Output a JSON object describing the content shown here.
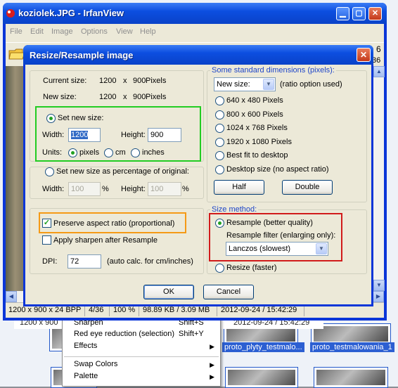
{
  "main_window": {
    "title": "koziolek.JPG - IrfanView",
    "menu": [
      "File",
      "Edit",
      "Image",
      "Options",
      "View",
      "Help"
    ],
    "toolbar_fragments": [
      "6",
      "36"
    ],
    "statusbar": {
      "dimensions": "1200 x 900 x 24 BPP",
      "index": "4/36",
      "zoom": "100 %",
      "size": "98.89 KB / 3.09 MB",
      "date": "2012-09-24 / 15:42:29"
    }
  },
  "background": {
    "status_dims": "1200 x 900",
    "status_date": "2012-09-24 / 15:42:29",
    "thumb_label_1": "proto_plyty_testmalo...",
    "thumb_label_2": "proto_testmalowania_1"
  },
  "context_menu": {
    "items": [
      {
        "label": "Sharpen",
        "shortcut": "Shift+S"
      },
      {
        "label": "Red eye reduction (selection)",
        "shortcut": "Shift+Y"
      },
      {
        "label": "Effects",
        "submenu": true
      },
      {
        "label": "Swap Colors",
        "submenu": true
      },
      {
        "label": "Palette",
        "submenu": true
      }
    ]
  },
  "dialog": {
    "title": "Resize/Resample image",
    "current_size_label": "Current size:",
    "current_width": "1200",
    "current_x": "x",
    "current_height": "900",
    "current_unit": "Pixels",
    "new_size_label": "New size:",
    "new_width": "1200",
    "new_x": "x",
    "new_height": "900",
    "new_unit": "Pixels",
    "set_new_size": {
      "label": "Set new size:",
      "width_label": "Width:",
      "width_value": "1200",
      "height_label": "Height:",
      "height_value": "900",
      "units_label": "Units:",
      "units": [
        "pixels",
        "cm",
        "inches"
      ]
    },
    "percentage": {
      "label": "Set new size as percentage of original:",
      "width_label": "Width:",
      "width_value": "100",
      "pct": "%",
      "height_label": "Height:",
      "height_value": "100"
    },
    "preserve_aspect": "Preserve aspect ratio (proportional)",
    "apply_sharpen": "Apply sharpen after Resample",
    "dpi_label": "DPI:",
    "dpi_value": "72",
    "dpi_note": "(auto calc. for cm/inches)",
    "standard_dims": {
      "legend": "Some standard dimensions (pixels):",
      "combo_value": "New size:",
      "combo_note": "(ratio option used)",
      "options": [
        "640 x 480 Pixels",
        "800 x 600 Pixels",
        "1024 x 768 Pixels",
        "1920 x 1080 Pixels",
        "Best fit to desktop",
        "Desktop size (no aspect ratio)"
      ],
      "half_button": "Half",
      "double_button": "Double"
    },
    "size_method": {
      "legend": "Size method:",
      "resample": "Resample (better quality)",
      "filter_label": "Resample filter (enlarging only):",
      "filter_value": "Lanczos (slowest)",
      "resize": "Resize (faster)"
    },
    "ok": "OK",
    "cancel": "Cancel"
  },
  "colors": {
    "highlight_green": "#22cc22",
    "highlight_orange": "#f59a16",
    "highlight_red": "#d11b1b",
    "xp_blue": "#0a42c8"
  }
}
